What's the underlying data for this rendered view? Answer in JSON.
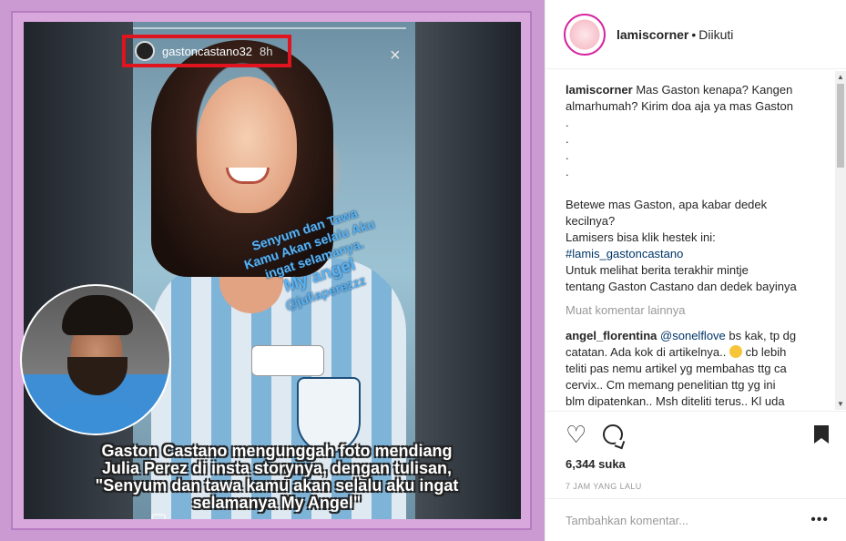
{
  "story": {
    "username": "gastoncastano32",
    "time": "8h",
    "close_icon": "×",
    "overlay_line1": "Senyum dan Tawa",
    "overlay_line2": "Kamu Akan selalu Aku",
    "overlay_line3": "ingat selamanya.",
    "overlay_angel": "My angel",
    "overlay_handle": "@juliaperezzz",
    "caption_lines": [
      "Gaston Castano mengunggah foto mendiang",
      "Julia Perez di insta storynya, dengan tulisan,",
      "\"Senyum dan tawa kamu akan selalu aku ingat",
      "selamanya My Angel\""
    ],
    "highlight_color": "#e0141e"
  },
  "header": {
    "username": "lamiscorner",
    "separator": "•",
    "follow_status": "Diikuti"
  },
  "caption_comment": {
    "username": "lamiscorner",
    "lines": [
      "Mas Gaston kenapa? Kangen",
      "almarhumah? Kirim doa aja ya mas Gaston",
      ".",
      ".",
      ".",
      ".",
      "",
      "Betewe mas Gaston, apa kabar dedek",
      "kecilnya?",
      "Lamisers bisa klik hestek ini:"
    ],
    "hashtag": "#lamis_gastoncastano",
    "lines_after": [
      "Untuk melihat berita terakhir mintje",
      "tentang Gaston Castano dan dedek bayinya"
    ]
  },
  "load_more": "Muat komentar lainnya",
  "comment2": {
    "username": "angel_florentina",
    "mention": "@sonelflove",
    "text1": " bs kak, tp dg",
    "text2": "catatan. Ada kok di artikelnya..",
    "text3": " cb lebih",
    "lines": [
      "teliti pas nemu artikel yg membahas ttg ca",
      "cervix.. Cm memang penelitian ttg yg ini",
      "blm dipatenkan.. Msh diteliti terus.. Kl uda"
    ]
  },
  "actions": {
    "likes": "6,344 suka",
    "time_ago": "7 JAM YANG LALU"
  },
  "add_comment": {
    "placeholder": "Tambahkan komentar...",
    "more": "•••"
  },
  "icons": {
    "heart": "heart-icon",
    "comment": "comment-icon",
    "bookmark": "bookmark-icon",
    "close": "close-icon",
    "camera": "camera-icon"
  }
}
